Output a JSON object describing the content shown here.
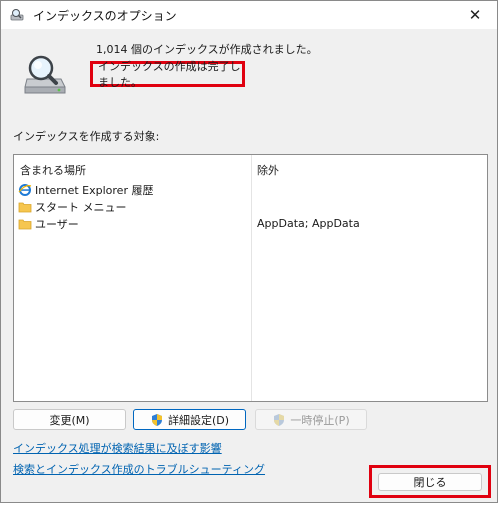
{
  "window": {
    "title": "インデックスのオプション"
  },
  "status": {
    "count_text": "1,014 個のインデックスが作成されました。",
    "complete_text": "インデックスの作成は完了しました。"
  },
  "locations": {
    "section_label": "インデックスを作成する対象:",
    "columns": {
      "included": "含まれる場所",
      "excluded": "除外"
    },
    "rows": [
      {
        "included": "Internet Explorer 履歴",
        "excluded": "",
        "icon": "internet-explorer-icon"
      },
      {
        "included": "スタート メニュー",
        "excluded": "",
        "icon": "folder-icon"
      },
      {
        "included": "ユーザー",
        "excluded": "AppData; AppData",
        "icon": "folder-icon"
      }
    ]
  },
  "buttons": {
    "modify": "変更(M)",
    "advanced": "詳細設定(D)",
    "pause": "一時停止(P)",
    "close": "閉じる"
  },
  "links": {
    "impact": "インデックス処理が検索結果に及ぼす影響",
    "troubleshoot": "検索とインデックス作成のトラブルシューティング"
  },
  "colors": {
    "highlight": "#e0000f",
    "link": "#0063b1",
    "primary_border": "#0067c0"
  }
}
